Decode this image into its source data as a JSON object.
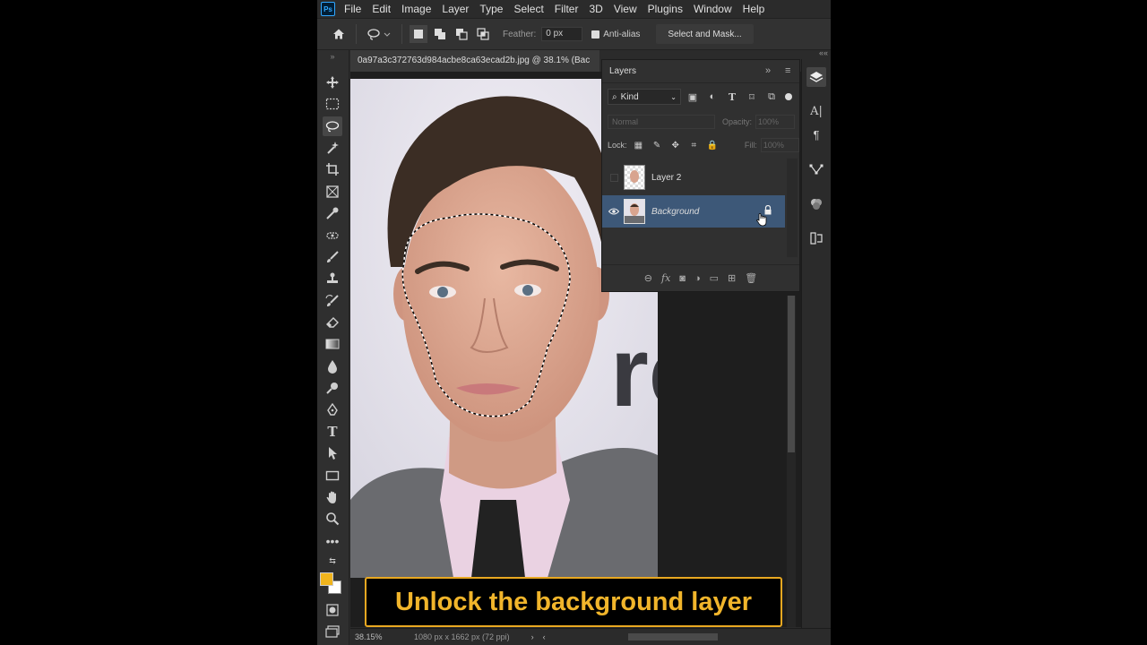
{
  "menu": {
    "logo": "Ps",
    "items": [
      "File",
      "Edit",
      "Image",
      "Layer",
      "Type",
      "Select",
      "Filter",
      "3D",
      "View",
      "Plugins",
      "Window",
      "Help"
    ]
  },
  "options": {
    "feather_label": "Feather:",
    "feather_value": "0 px",
    "antialias_label": "Anti-alias",
    "select_mask_label": "Select and Mask..."
  },
  "document": {
    "tab_title": "0a97a3c372763d984acbe8ca63ecad2b.jpg @ 38.1% (Bac"
  },
  "layers_panel": {
    "title": "Layers",
    "kind_label": "Kind",
    "blend_mode": "Normal",
    "opacity_label": "Opacity:",
    "opacity_value": "100%",
    "lock_label": "Lock:",
    "fill_label": "Fill:",
    "fill_value": "100%",
    "layers": [
      {
        "name": "Layer 2",
        "visible": false,
        "selected": false
      },
      {
        "name": "Background",
        "visible": true,
        "selected": true,
        "locked": true
      }
    ]
  },
  "status": {
    "zoom": "38.15%",
    "doc_size": "1080 px x 1662 px (72 ppi)"
  },
  "caption": {
    "text": "Unlock the background layer"
  },
  "colors": {
    "foreground": "#f0b41c",
    "background": "#ffffff",
    "selected_layer": "#3d5878",
    "caption_accent": "#f1b52b"
  }
}
